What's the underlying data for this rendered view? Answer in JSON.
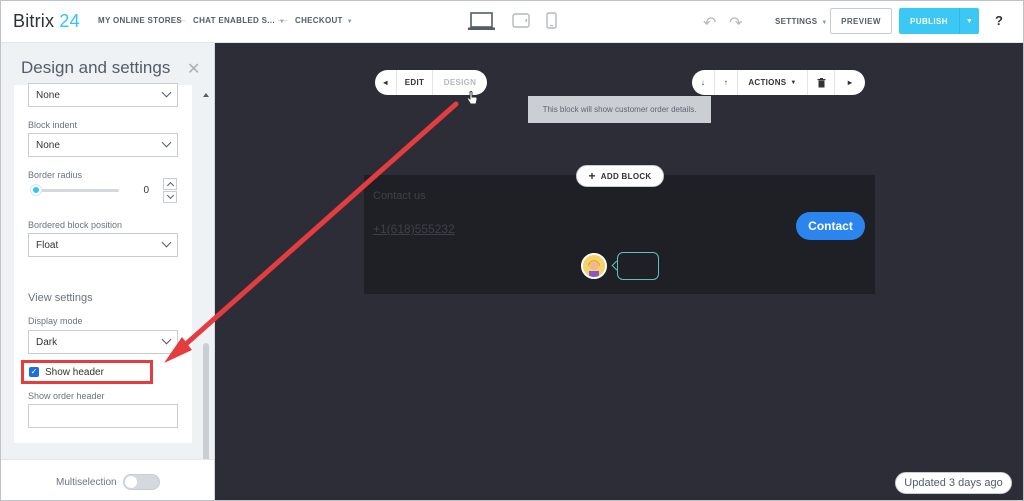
{
  "app": {
    "logo_text": "Bitrix",
    "logo_num": "24"
  },
  "breadcrumbs": [
    {
      "label": "MY ONLINE STORES",
      "has_caret": false
    },
    {
      "label": "CHAT ENABLED S...",
      "has_caret": true
    },
    {
      "label": "CHECKOUT",
      "has_caret": true
    }
  ],
  "devices": [
    "desktop-icon",
    "tablet-icon",
    "mobile-icon"
  ],
  "toolbar": {
    "settings_label": "SETTINGS",
    "preview_label": "PREVIEW",
    "publish_label": "PUBLISH",
    "help_label": "?",
    "accent": "#3bc8f5"
  },
  "sidebar": {
    "title": "Design and settings",
    "fields": {
      "top_select_value": "None",
      "block_indent_label": "Block indent",
      "block_indent_value": "None",
      "border_radius_label": "Border radius",
      "border_radius_value": "0",
      "bordered_position_label": "Bordered block position",
      "bordered_position_value": "Float"
    },
    "view_settings": {
      "title": "View settings",
      "display_mode_label": "Display mode",
      "display_mode_value": "Dark",
      "show_header_label": "Show header",
      "show_header_checked": true,
      "show_order_header_label": "Show order header",
      "show_order_header_value": ""
    },
    "footer": {
      "multiselection_label": "Multiselection",
      "multiselection_on": false
    }
  },
  "canvas": {
    "edit_label": "EDIT",
    "design_label": "DESIGN",
    "actions_label": "ACTIONS",
    "tooltip": "This block will show customer order details.",
    "add_block_label": "ADD BLOCK",
    "block": {
      "contact_us": "Contact us",
      "phone": "+1(618)555232",
      "contact_button": "Contact"
    },
    "updated": "Updated 3 days ago",
    "background": "#2c2d37"
  },
  "annotation": {
    "color": "#e53c3f"
  }
}
